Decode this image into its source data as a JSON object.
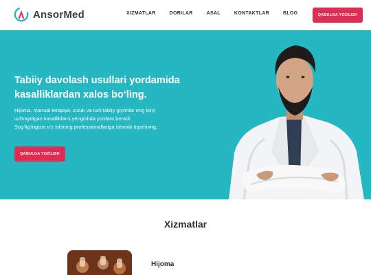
{
  "brand": {
    "name": "AnsorMed",
    "logo_icon": "letter-a-logo-icon",
    "accent": "#df2c52",
    "logo_ring": "#25b7c2"
  },
  "nav": [
    {
      "label": "XIZMATLAR"
    },
    {
      "label": "DORILAR"
    },
    {
      "label": "ASAL"
    },
    {
      "label": "KONTAKTLAR"
    },
    {
      "label": "BLOG"
    }
  ],
  "header": {
    "cta_label": "QABULGA YOZILISH"
  },
  "hero": {
    "background": "#25b7c2",
    "title": "Tabiiy davolash usullari yordamida kasalliklardan xalos bo‘ling.",
    "text": "Hijoma, manual terapiya, zuluk va turli tabiiy giyohlar eng ko‘p uchraydigan kasalliklarni yengishda yordam beradi. Sog‘lig‘ingizni o‘z ishining professionallariga ishonib topshiring.",
    "cta_label": "QABULGA YOZILISH"
  },
  "services": {
    "title": "Xizmatlar",
    "items": [
      {
        "name": "Hijoma"
      }
    ]
  }
}
